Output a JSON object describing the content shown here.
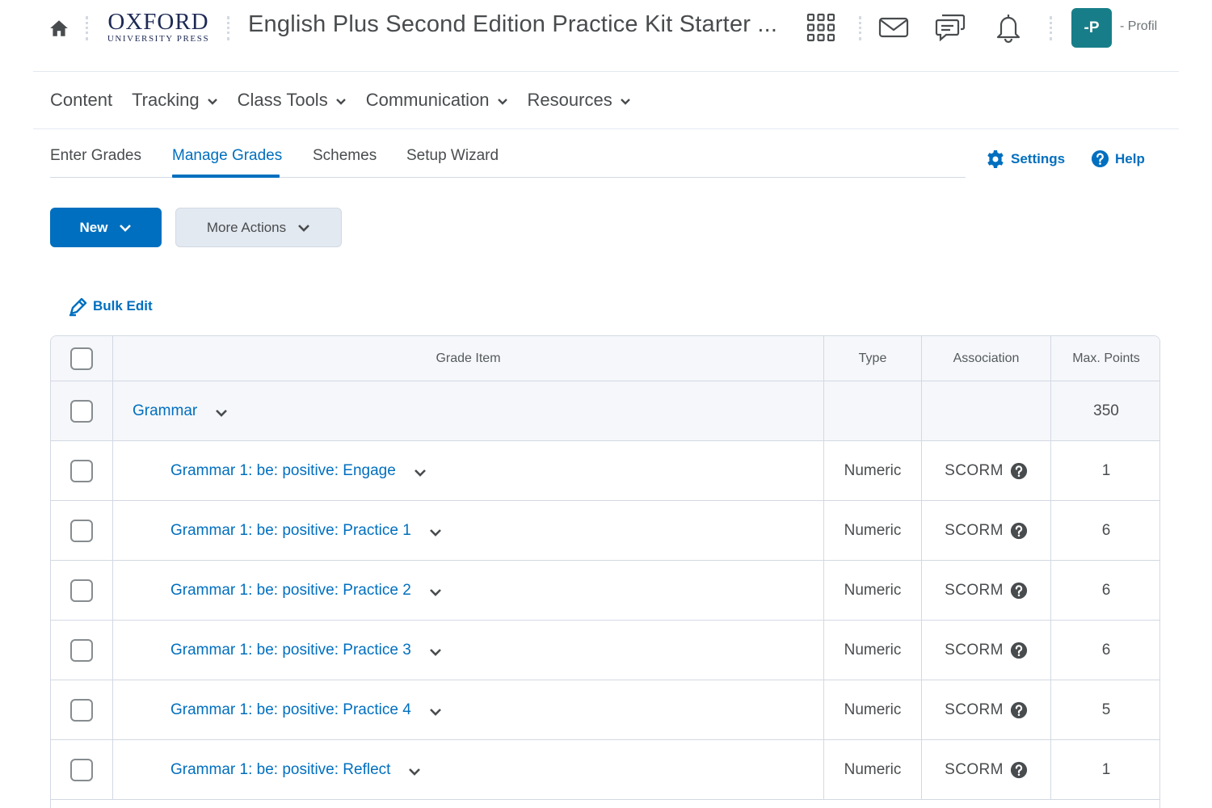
{
  "header": {
    "logo_main": "OXFORD",
    "logo_sub": "UNIVERSITY PRESS",
    "course_title": "English Plus Second Edition Practice Kit Starter ...",
    "avatar_initials": "-P",
    "profile_label": "- Profil"
  },
  "nav": {
    "items": [
      {
        "label": "Content",
        "has_menu": false
      },
      {
        "label": "Tracking",
        "has_menu": true
      },
      {
        "label": "Class Tools",
        "has_menu": true
      },
      {
        "label": "Communication",
        "has_menu": true
      },
      {
        "label": "Resources",
        "has_menu": true
      }
    ]
  },
  "tabs": {
    "items": [
      "Enter Grades",
      "Manage Grades",
      "Schemes",
      "Setup Wizard"
    ],
    "active": "Manage Grades",
    "settings_label": "Settings",
    "help_label": "Help"
  },
  "actions": {
    "new_label": "New",
    "more_label": "More Actions",
    "bulk_edit_label": "Bulk Edit"
  },
  "table": {
    "columns": {
      "grade_item": "Grade Item",
      "type": "Type",
      "association": "Association",
      "max_points": "Max. Points"
    },
    "category": {
      "name": "Grammar",
      "max_points": "350"
    },
    "rows": [
      {
        "name": "Grammar 1: be: positive: Engage",
        "type": "Numeric",
        "association": "SCORM",
        "max_points": "1"
      },
      {
        "name": "Grammar 1: be: positive: Practice 1",
        "type": "Numeric",
        "association": "SCORM",
        "max_points": "6"
      },
      {
        "name": "Grammar 1: be: positive: Practice 2",
        "type": "Numeric",
        "association": "SCORM",
        "max_points": "6"
      },
      {
        "name": "Grammar 1: be: positive: Practice 3",
        "type": "Numeric",
        "association": "SCORM",
        "max_points": "6"
      },
      {
        "name": "Grammar 1: be: positive: Practice 4",
        "type": "Numeric",
        "association": "SCORM",
        "max_points": "5"
      },
      {
        "name": "Grammar 1: be: positive: Reflect",
        "type": "Numeric",
        "association": "SCORM",
        "max_points": "1"
      }
    ]
  },
  "colors": {
    "accent": "#006fbf",
    "avatar_bg": "#177e89",
    "text": "#494c4e",
    "border": "#d3d9e3"
  }
}
